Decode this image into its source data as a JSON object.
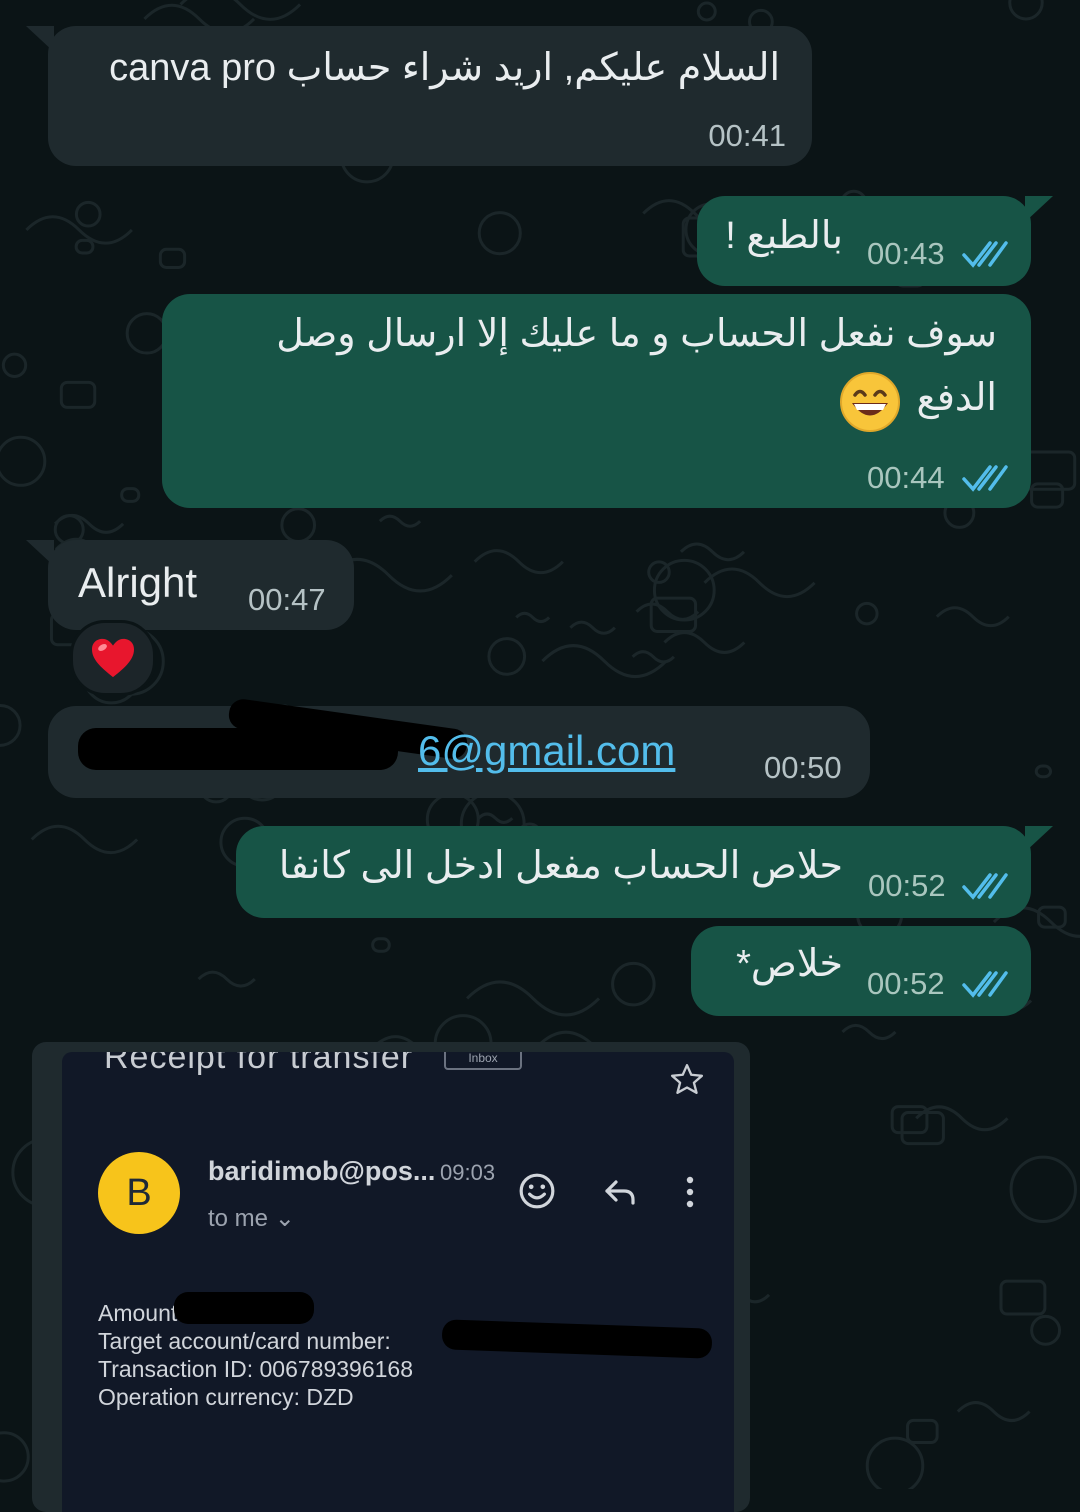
{
  "colors": {
    "incoming_bubble": "#1f2a2e",
    "outgoing_bubble": "#175446",
    "background": "#0b1416",
    "link": "#53bdeb",
    "read_ticks": "#53bdeb"
  },
  "messages": [
    {
      "dir": "in",
      "text": "السلام عليكم, اريد شراء حساب canva pro",
      "time": "00:41"
    },
    {
      "dir": "out",
      "text": "بالطبع !",
      "time": "00:43",
      "status": "read"
    },
    {
      "dir": "out",
      "text_line1": "سوف نفعل الحساب و ما عليك إلا ارسال وصل",
      "text_line2": "الدفع",
      "emoji": "grinning-face-icon",
      "time": "00:44",
      "status": "read"
    },
    {
      "dir": "in",
      "text": "Alright",
      "time": "00:47",
      "reaction": "heart-icon"
    },
    {
      "dir": "in",
      "text": "6@gmail.com",
      "time": "00:50",
      "redacted_prefix": true
    },
    {
      "dir": "out",
      "text": "حلاص الحساب مفعل ادخل الى كانفا",
      "time": "00:52",
      "status": "read"
    },
    {
      "dir": "out",
      "text": "خلاص*",
      "time": "00:52",
      "status": "read"
    }
  ],
  "receipt": {
    "title": "Receipt for transfer",
    "badge": "Inbox",
    "avatar_letter": "B",
    "sender": "baridimob@pos...",
    "time": "09:03",
    "to": "to me",
    "lines": [
      "Amount: ",
      "Target account/card number: ",
      "Transaction ID: 006789396168",
      "Operation currency: DZD"
    ]
  }
}
